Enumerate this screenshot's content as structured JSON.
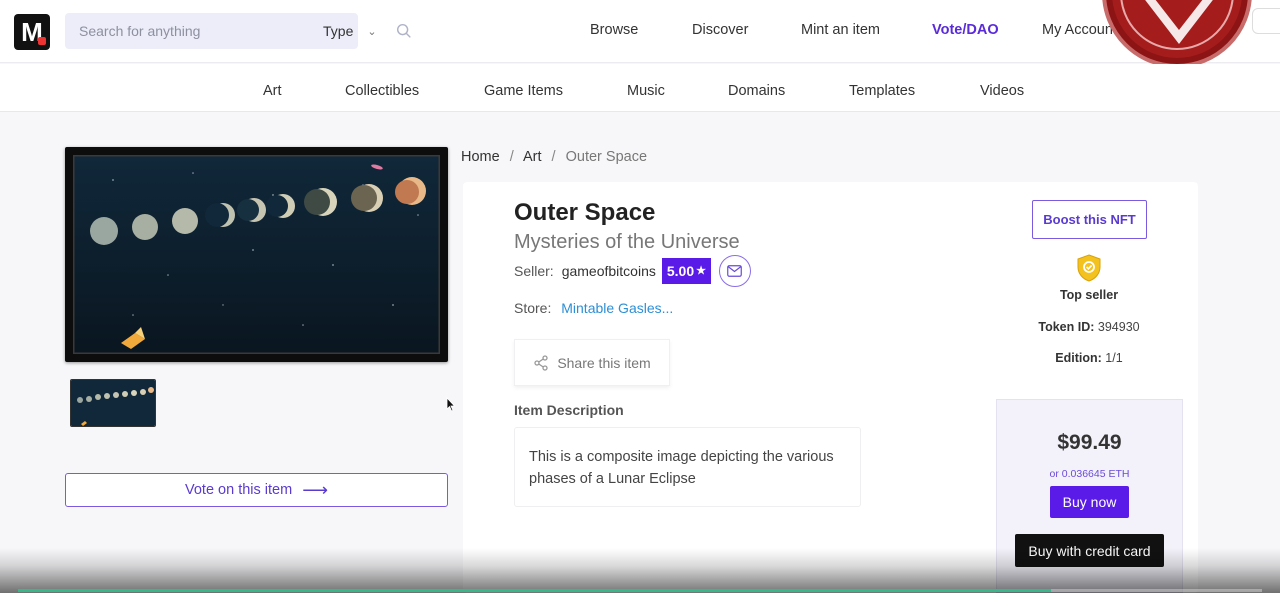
{
  "header": {
    "logo_text": "M",
    "search": {
      "placeholder": "Search for anything",
      "value": ""
    },
    "type_select": {
      "label": "Type"
    },
    "nav": [
      {
        "label": "Browse",
        "active": false
      },
      {
        "label": "Discover",
        "active": false
      },
      {
        "label": "Mint an item",
        "active": false
      },
      {
        "label": "Vote/DAO",
        "active": true
      },
      {
        "label": "My Account",
        "active": false
      }
    ]
  },
  "categories": [
    "Art",
    "Collectibles",
    "Game Items",
    "Music",
    "Domains",
    "Templates",
    "Videos"
  ],
  "breadcrumb": {
    "home": "Home",
    "section": "Art",
    "current": "Outer Space",
    "separator": "/"
  },
  "item": {
    "title": "Outer Space",
    "subtitle": "Mysteries of the Universe",
    "seller_label": "Seller:",
    "seller_name": "gameofbitcoins",
    "rating": "5.00",
    "store_label": "Store:",
    "store_name": "Mintable Gasles...",
    "share_label": "Share this item",
    "description_label": "Item Description",
    "description": "This is a composite image depicting the various phases of a Lunar Eclipse",
    "vote_label": "Vote on this item"
  },
  "sidebar": {
    "boost_label": "Boost this NFT",
    "top_seller_label": "Top seller",
    "token_id_label": "Token ID:",
    "token_id": "394930",
    "edition_label": "Edition:",
    "edition": "1/1",
    "price": "$99.49",
    "eth_price": "or 0.036645 ETH",
    "buy_label": "Buy now",
    "credit_card_label": "Buy with credit card"
  },
  "video_player": {
    "progress": 0.83
  },
  "colors": {
    "accent": "#5a1be8",
    "vote_active": "#5a2bd8",
    "link": "#2d8fd5",
    "dark_button": "#111111",
    "stamp_red": "#a51c1c"
  }
}
